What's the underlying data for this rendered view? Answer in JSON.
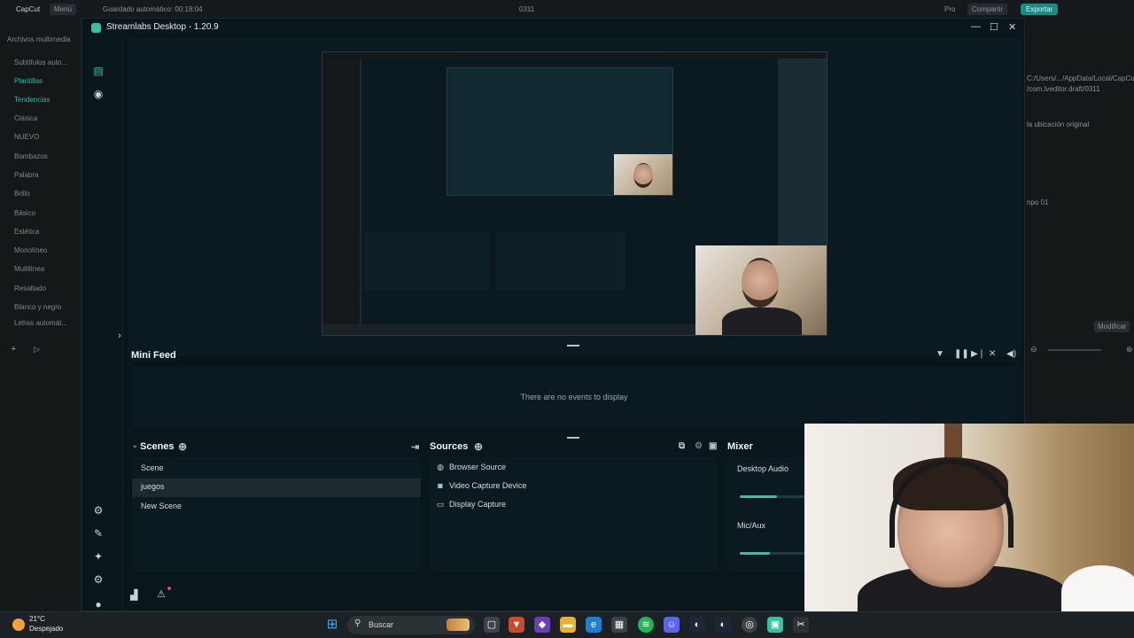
{
  "capcut": {
    "autosave": "Guardado automático: 00:18:04",
    "logo": "CapCut",
    "menu": "Menú",
    "project": "0311",
    "pro": "Pro",
    "share": "Compartir",
    "export": "Exportar",
    "media_label": "Archivos multimedia",
    "sidebar_items": [
      "Subtítulos auto...",
      "Plantillas",
      "Tendencias",
      "Clásica",
      "NUEVO",
      "Bombazos",
      "Palabra",
      "Brillo",
      "Básico",
      "Estética",
      "Monolíneo",
      "Multilínea",
      "Resaltado",
      "Blanco y negro",
      "Letras automát..."
    ],
    "right_path": "C:/Users/.../AppData/Local/CapCut/User",
    "right_path2": "/com.lveditor.draft/0311",
    "right_loc": "la ubicación original",
    "right_clip": "npo 01",
    "modify": "Modificar"
  },
  "streamlabs": {
    "title": "Streamlabs Desktop - 1.20.9",
    "minimize": "—",
    "maximize": "☐",
    "close": "✕",
    "mini_feed": {
      "title": "Mini Feed",
      "empty": "There are no events to display"
    },
    "scenes": {
      "title": "Scenes",
      "items": [
        "Scene",
        "juegos",
        "New Scene"
      ],
      "selected": 1
    },
    "sources": {
      "title": "Sources",
      "items": [
        {
          "label": "Browser Source",
          "icon": "globe-icon",
          "glyph": "🌐"
        },
        {
          "label": "Video Capture Device",
          "icon": "camera-icon",
          "glyph": "👤"
        },
        {
          "label": "Display Capture",
          "icon": "monitor-icon",
          "glyph": "🖵"
        }
      ]
    },
    "mixer": {
      "title": "Mixer",
      "channels": [
        {
          "label": "Desktop Audio",
          "level": 0.55
        },
        {
          "label": "Mic/Aux",
          "level": 0.45
        }
      ],
      "accent": "#31c3a2"
    }
  },
  "taskbar": {
    "temp": "21°C",
    "condition": "Despejado",
    "search": "Buscar"
  }
}
